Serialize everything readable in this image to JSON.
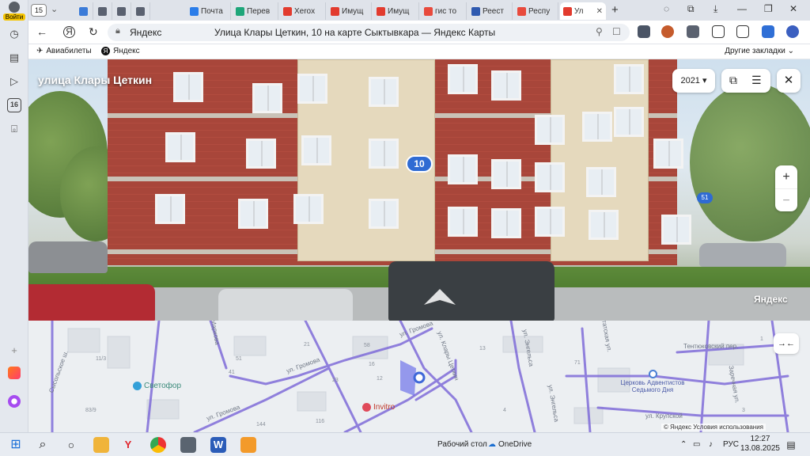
{
  "rail": {
    "login_label": "Войти",
    "items": [
      "clock-icon",
      "collections-icon",
      "play-icon",
      "calendar-icon",
      "screenshot-icon"
    ],
    "calendar_day": "16",
    "bottom_items": [
      "add-icon",
      "alice-apps-icon",
      "alice-icon"
    ]
  },
  "tabs": {
    "count": "15",
    "items": [
      {
        "label": "",
        "color": "#3b7bd8"
      },
      {
        "label": "",
        "color": "#5a6170"
      },
      {
        "label": "",
        "color": "#5a6170"
      },
      {
        "label": "",
        "color": "#5a6170"
      },
      {
        "label": "Почта",
        "color": "#2b7de9"
      },
      {
        "label": "Перев",
        "color": "#1ea67a"
      },
      {
        "label": "Xerox",
        "color": "#e23b2e"
      },
      {
        "label": "Имущ",
        "color": "#e23b2e"
      },
      {
        "label": "Имущ",
        "color": "#e23b2e"
      },
      {
        "label": "гис то",
        "color": "#e84a3c"
      },
      {
        "label": "Реест",
        "color": "#2f5ab0"
      },
      {
        "label": "Респу",
        "color": "#e84a3c"
      },
      {
        "label": "Ул",
        "color": "#e23b2e",
        "active": true
      }
    ],
    "new_tab": "+"
  },
  "address": {
    "host": "Яндекс",
    "title": "Улица Клары Цеткин, 10 на карте Сыктывкара — Яндекс Карты"
  },
  "bookmarks": {
    "items": [
      {
        "label": "Авиабилеты",
        "icon": "plane-icon"
      },
      {
        "label": "Яндекс",
        "icon": "yandex-icon"
      }
    ],
    "other": "Другие закладки"
  },
  "panorama": {
    "street_title": "улица Клары Цеткин",
    "house_number": "10",
    "neighbor_number": "51",
    "year": "2021",
    "logo": "Яндекс"
  },
  "map": {
    "labels": [
      {
        "text": "ул. Громова",
        "name": "label-gromova-1"
      },
      {
        "text": "ул. Громова",
        "name": "label-gromova-2"
      },
      {
        "text": "ул. Громова",
        "name": "label-gromova-3"
      },
      {
        "text": "ул. Энгельса",
        "name": "label-engelsa"
      },
      {
        "text": "ул. Энгельса",
        "name": "label-engelsa-2"
      },
      {
        "text": "ул. Клары Цеткин",
        "name": "label-tsetkin"
      },
      {
        "text": "Тентюковский пер.",
        "name": "label-tentyukovsky"
      },
      {
        "text": "ул. Крупской",
        "name": "label-krupskoy"
      },
      {
        "text": "Депутатская ул.",
        "name": "label-deputatskaya"
      },
      {
        "text": "Заречная ул.",
        "name": "label-zarechnaya"
      },
      {
        "text": "Сысольское ш.",
        "name": "label-sysolskoe"
      },
      {
        "text": "Маркова",
        "name": "label-markova"
      }
    ],
    "pois": [
      {
        "text": "Светофор",
        "color": "#34a0d8"
      },
      {
        "text": "Invitro",
        "color": "#e04a5a"
      },
      {
        "text": "Церковь Адвентистов Седьмого Дня",
        "color": "#4a7fd4"
      }
    ],
    "house_numbers": [
      "11/3",
      "83/9",
      "41",
      "21",
      "58",
      "116",
      "144",
      "23",
      "12",
      "51",
      "16",
      "13",
      "4",
      "71",
      "1",
      "3"
    ],
    "copyright": "© Яндекс",
    "terms": "Условия использования"
  },
  "taskbar": {
    "desktop_label": "Рабочий стол",
    "onedrive_label": "OneDrive",
    "lang": "РУС",
    "time": "12:27",
    "date": "13.08.2025"
  }
}
